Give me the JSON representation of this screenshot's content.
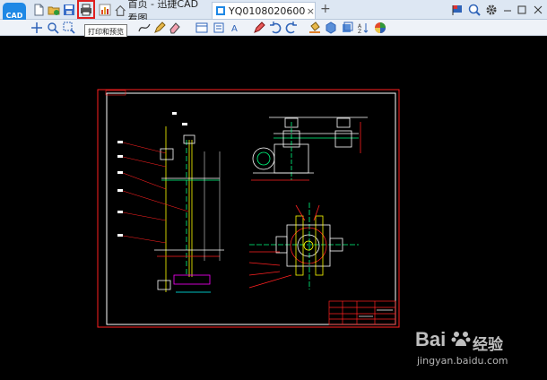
{
  "app": {
    "logo_text": "CAD",
    "home_tab_label": "首页 - 迅捷CAD看图",
    "doc_tab_label": "YQ0108020600(2)....",
    "new_tab_symbol": "+",
    "close_tab_symbol": "×"
  },
  "tooltip": {
    "text": "打印和预览"
  },
  "watermark": {
    "brand": "Bai",
    "sub": "经验",
    "url": "jingyan.baidu.com"
  },
  "colors": {
    "highlight": "#e02020",
    "canvas": "#000000",
    "frame": "#ff2020",
    "drawing": "#ffffff"
  }
}
